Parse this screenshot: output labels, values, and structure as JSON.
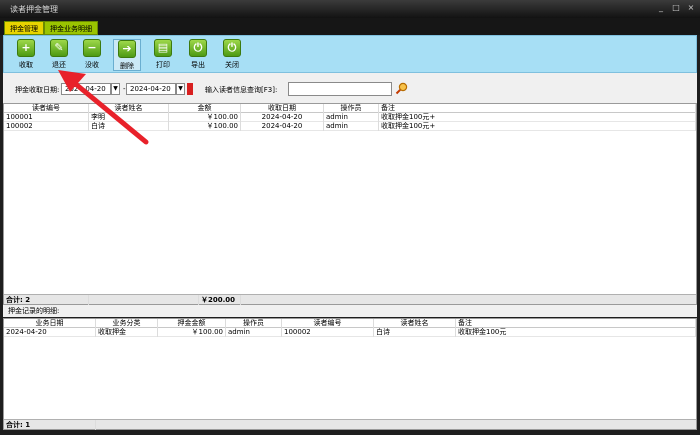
{
  "window": {
    "title": "读者押金管理",
    "min": "_",
    "max": "□",
    "close": "×"
  },
  "tabs": [
    {
      "label": "押金管理"
    },
    {
      "label": "押金业务明细"
    }
  ],
  "toolbar": [
    {
      "label": "收取",
      "icon": "plus-icon",
      "glyph": "+"
    },
    {
      "label": "退还",
      "icon": "wrench-icon",
      "glyph": "✎"
    },
    {
      "label": "没收",
      "icon": "minus-icon",
      "glyph": "−"
    },
    {
      "label": "删除",
      "icon": "arrow-right-icon",
      "glyph": "➔"
    },
    {
      "label": "打印",
      "icon": "print-icon",
      "glyph": "▤"
    },
    {
      "label": "导出",
      "icon": "power-icon",
      "glyph": "⏻"
    },
    {
      "label": "关闭",
      "icon": "power-icon",
      "glyph": "⏻"
    }
  ],
  "filter": {
    "label": "押金收取日期:",
    "from": "2024-04-20",
    "to": "2024-04-20",
    "separator": "-",
    "query_label": "输入读者信息查询[F3]:",
    "query_value": ""
  },
  "main_grid": {
    "headers": [
      "读者编号",
      "读者姓名",
      "金额",
      "收取日期",
      "操作员",
      "备注"
    ],
    "rows": [
      [
        "100001",
        "李明",
        "￥100.00",
        "2024-04-20",
        "admin",
        "收取押金100元+"
      ],
      [
        "100002",
        "白诗",
        "￥100.00",
        "2024-04-20",
        "admin",
        "收取押金100元+"
      ]
    ],
    "footer_label": "合计: 2",
    "footer_total": "￥200.00"
  },
  "detail": {
    "title": "押金记录的明细:",
    "headers": [
      "业务日期",
      "业务分类",
      "押金金额",
      "操作员",
      "读者编号",
      "读者姓名",
      "备注"
    ],
    "rows": [
      [
        "2024-04-20",
        "收取押金",
        "￥100.00",
        "admin",
        "100002",
        "白诗",
        "收取押金100元"
      ]
    ],
    "footer_label": "合计: 1"
  },
  "colors": {
    "toolbar_bg": "#a7dff5",
    "tab_active": "#e8d400",
    "tab_inactive": "#9ac400",
    "annotation_arrow": "#e8212a"
  }
}
